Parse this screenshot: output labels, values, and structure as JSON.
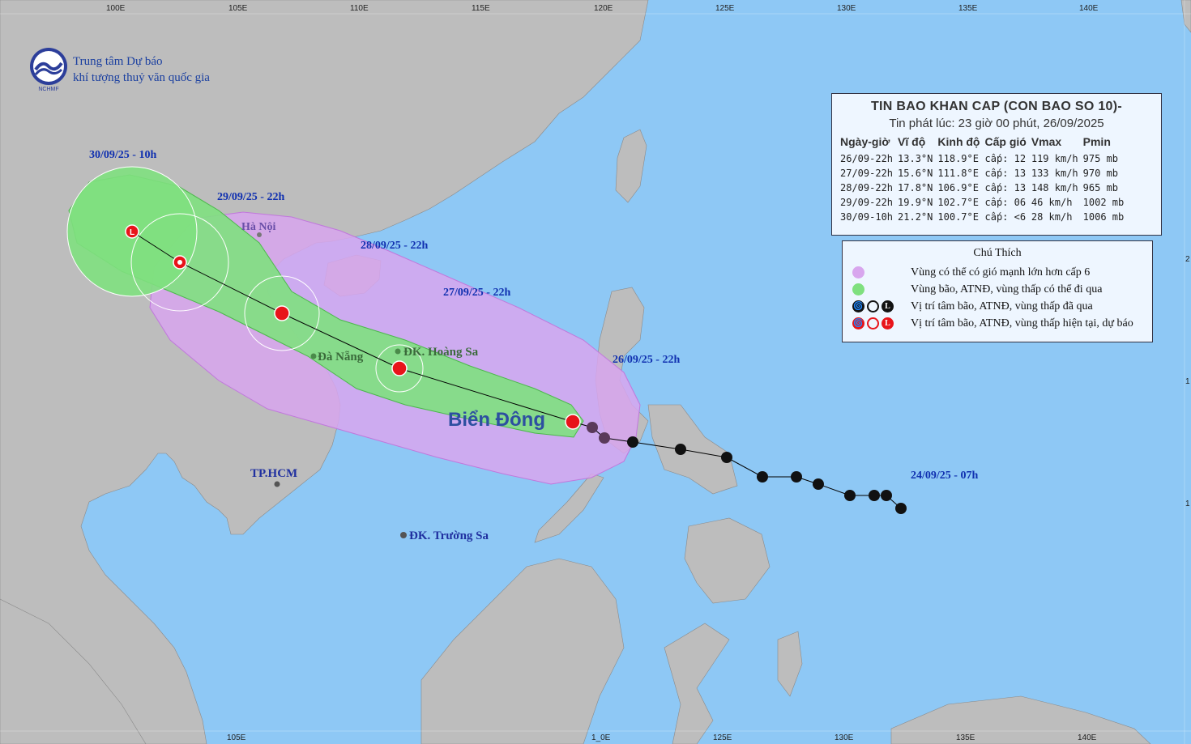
{
  "agency": {
    "line1": "Trung tâm Dự báo",
    "line2": "khí tượng thuỷ văn quốc gia",
    "logo_text": "NCHMF"
  },
  "bulletin": {
    "title": "TIN BAO KHAN CAP (CON BAO SO 10)-",
    "issued": "Tin phát lúc: 23 giờ 00 phút, 26/09/2025",
    "columns": [
      "Ngày-giờ",
      "Vĩ độ",
      "Kinh độ",
      "Cấp gió",
      "Vmax",
      "Pmin"
    ],
    "rows": [
      [
        "26/09-22h",
        "13.3°N",
        "118.9°E",
        "cấp: 12",
        "119 km/h",
        "975 mb"
      ],
      [
        "27/09-22h",
        "15.6°N",
        "111.8°E",
        "cấp: 13",
        "133 km/h",
        "970 mb"
      ],
      [
        "28/09-22h",
        "17.8°N",
        "106.9°E",
        "cấp: 13",
        "148 km/h",
        "965 mb"
      ],
      [
        "29/09-22h",
        "19.9°N",
        "102.7°E",
        "cấp: 06",
        "46 km/h",
        "1002 mb"
      ],
      [
        "30/09-10h",
        "21.2°N",
        "100.7°E",
        "cấp: <6",
        "28 km/h",
        "1006 mb"
      ]
    ]
  },
  "legend": {
    "title": "Chú Thích",
    "items": [
      {
        "label": "Vùng có thể có gió mạnh lớn hơn cấp 6",
        "color": "#d8a6ee"
      },
      {
        "label": "Vùng bão, ATNĐ, vùng thấp có thể đi qua",
        "color": "#7fe07f"
      },
      {
        "label": "Vị trí tâm bão, ATNĐ, vùng thấp đã qua",
        "color": "#111111"
      },
      {
        "label": "Vị trí tâm bão, ATNĐ, vùng thấp hiện tại, dự báo",
        "color": "#e8141a"
      }
    ],
    "marker_L": "L"
  },
  "map_labels": {
    "t_0930": "30/09/25 - 10h",
    "t_0929": "29/09/25 - 22h",
    "t_0928": "28/09/25 - 22h",
    "t_0927": "27/09/25 - 22h",
    "t_0926": "26/09/25 - 22h",
    "t_0924": "24/09/25 - 07h",
    "hanoi": "Hà Nội",
    "danang": "Đà Nẵng",
    "hoangsa": "ĐK. Hoàng Sa",
    "hcm": "TP.HCM",
    "truongsa": "ĐK. Trường Sa",
    "sea": "Biển Đông"
  },
  "axis": {
    "top_ticks": [
      "100E",
      "105E",
      "110E",
      "115E",
      "120E",
      "125E",
      "130E",
      "135E",
      "140E"
    ],
    "bottom_ticks": [
      "105E",
      "1_0E",
      "125E",
      "130E",
      "135E",
      "140E"
    ],
    "right_ticks": [
      "2",
      "1",
      "1"
    ]
  },
  "colors": {
    "sea": "#8ec8f5",
    "land": "#bdbdbd",
    "cone": "#d8a6ee",
    "track": "#7fe07f",
    "current": "#e8141a",
    "past": "#111111"
  }
}
